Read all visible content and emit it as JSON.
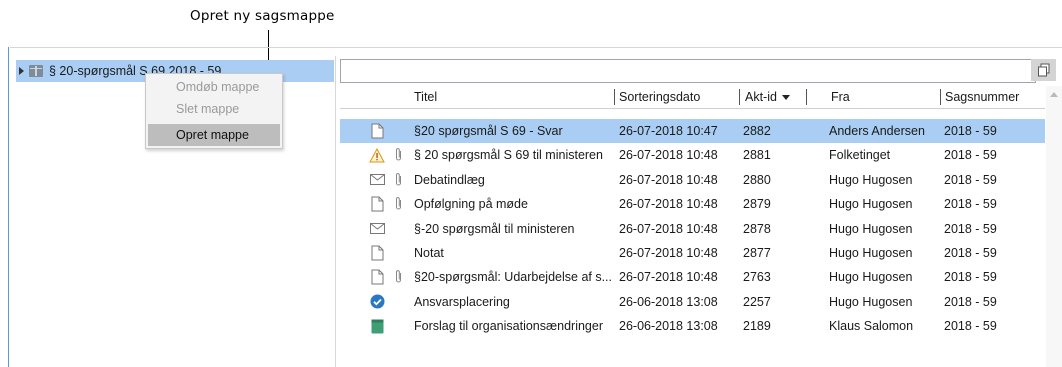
{
  "annotation": {
    "label": "Opret ny sagsmappe"
  },
  "tree": {
    "node_label": "§ 20-spørgsmål S 69 2018 - 59"
  },
  "context_menu": {
    "items": [
      {
        "label": "Omdøb mappe",
        "enabled": false
      },
      {
        "label": "Slet mappe",
        "enabled": false
      },
      {
        "label": "Opret mappe",
        "enabled": true,
        "highlighted": true
      }
    ]
  },
  "search": {
    "value": ""
  },
  "table": {
    "columns": [
      {
        "label": "Titel"
      },
      {
        "label": "Sorteringsdato"
      },
      {
        "label": "Akt-id",
        "sorted": "desc"
      },
      {
        "label": "Fra"
      },
      {
        "label": "Sagsnummer"
      }
    ],
    "rows": [
      {
        "icon": "document-icon",
        "attachment": false,
        "title": "§20 spørgsmål S 69 - Svar",
        "date": "26-07-2018 10:47",
        "akt_id": "2882",
        "fra": "Anders Andersen",
        "sagsnummer": "2018 - 59",
        "selected": true
      },
      {
        "icon": "warning-icon",
        "attachment": true,
        "title": "§ 20 spørgsmål S 69 til ministeren",
        "date": "26-07-2018 10:48",
        "akt_id": "2881",
        "fra": "Folketinget",
        "sagsnummer": "2018 - 59",
        "selected": false
      },
      {
        "icon": "envelope-icon",
        "attachment": true,
        "title": "Debatindlæg",
        "date": "26-07-2018 10:48",
        "akt_id": "2880",
        "fra": "Hugo Hugosen",
        "sagsnummer": "2018 - 59",
        "selected": false
      },
      {
        "icon": "document-icon",
        "attachment": true,
        "title": "Opfølgning på møde",
        "date": "26-07-2018 10:48",
        "akt_id": "2879",
        "fra": "Hugo Hugosen",
        "sagsnummer": "2018 - 59",
        "selected": false
      },
      {
        "icon": "envelope-icon",
        "attachment": false,
        "title": "§-20 spørgsmål til ministeren",
        "date": "26-07-2018 10:48",
        "akt_id": "2878",
        "fra": "Hugo Hugosen",
        "sagsnummer": "2018 - 59",
        "selected": false
      },
      {
        "icon": "document-icon",
        "attachment": false,
        "title": "Notat",
        "date": "26-07-2018 10:48",
        "akt_id": "2877",
        "fra": "Hugo Hugosen",
        "sagsnummer": "2018 - 59",
        "selected": false
      },
      {
        "icon": "document-icon",
        "attachment": true,
        "title": "§20-spørgsmål: Udarbejdelse af s...",
        "date": "26-07-2018 10:48",
        "akt_id": "2763",
        "fra": "Hugo Hugosen",
        "sagsnummer": "2018 - 59",
        "selected": false
      },
      {
        "icon": "check-circle-icon",
        "attachment": false,
        "title": "Ansvarsplacering",
        "date": "26-06-2018 13:08",
        "akt_id": "2257",
        "fra": "Hugo Hugosen",
        "sagsnummer": "2018 - 59",
        "selected": false
      },
      {
        "icon": "green-task-icon",
        "attachment": false,
        "title": "Forslag til organisationsændringer",
        "date": "26-06-2018 13:08",
        "akt_id": "2189",
        "fra": "Klaus Salomon",
        "sagsnummer": "2018 - 59",
        "selected": false
      }
    ]
  },
  "colors": {
    "selection": "#a9cdf3",
    "accent": "#5a9bd5",
    "check": "#2b78c2",
    "task": "#3f9e76",
    "warning": "#e8a317"
  }
}
